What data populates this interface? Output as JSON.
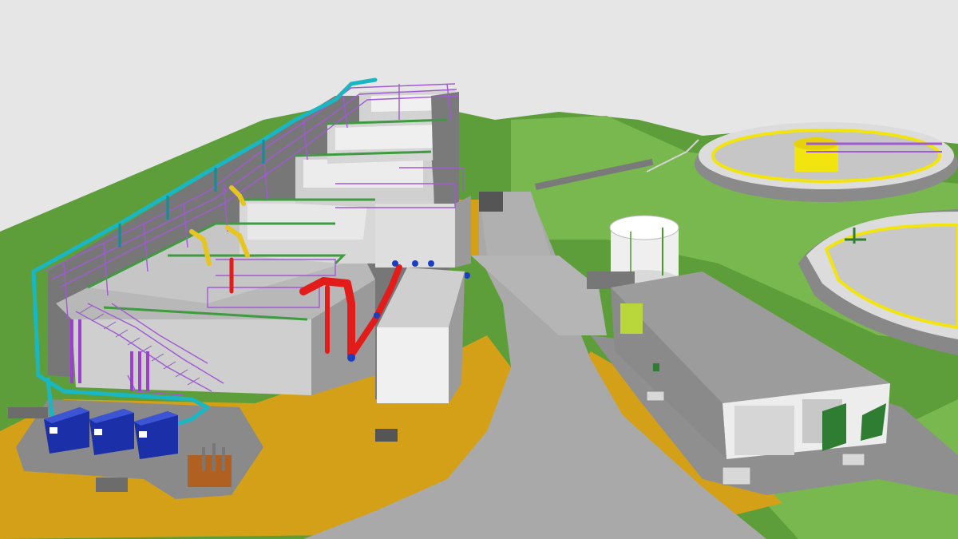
{
  "scene": {
    "colors": {
      "sky": "#e6e6e6",
      "grass": "#5e9e3a",
      "grass_light": "#79b84e",
      "pad_orange": "#d4a017",
      "road": "#a9a9a9",
      "concrete": "#c9c9c9",
      "concrete_dark": "#8c8c8c",
      "wall_dark": "#5c5c5c",
      "pipe_cyan": "#19b7c4",
      "pipe_red": "#e21b1b",
      "handrail_purple": "#a05ad4",
      "clarifier_yellow": "#f2e40f",
      "transformer_blue": "#1b2fa8",
      "tank_white": "#f2f2f2"
    },
    "objects": [
      "process-basin-structure",
      "walkway-with-handrails",
      "cyan-process-pipe",
      "red-pump-piping",
      "equipment-room-box",
      "blue-transformers",
      "cylindrical-tank",
      "control-building",
      "circular-clarifier-1",
      "circular-clarifier-2",
      "access-road"
    ]
  }
}
